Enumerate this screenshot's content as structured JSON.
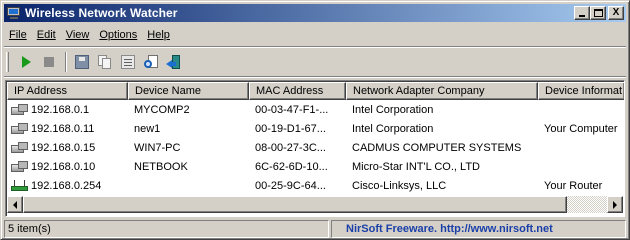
{
  "window": {
    "title": "Wireless Network Watcher",
    "icon": "computer-monitor-icon"
  },
  "titlebar_buttons": {
    "minimize": "minimize",
    "maximize": "maximize",
    "close": "X"
  },
  "menu": [
    {
      "label": "File"
    },
    {
      "label": "Edit"
    },
    {
      "label": "View"
    },
    {
      "label": "Options"
    },
    {
      "label": "Help"
    }
  ],
  "toolbar": {
    "buttons": [
      {
        "icon": "play-icon"
      },
      {
        "icon": "stop-icon"
      },
      {
        "icon": "save-icon"
      },
      {
        "icon": "copy-icon"
      },
      {
        "icon": "properties-icon"
      },
      {
        "icon": "find-icon"
      },
      {
        "icon": "exit-icon"
      }
    ]
  },
  "table": {
    "columns": [
      "IP Address",
      "Device Name",
      "MAC Address",
      "Network Adapter Company",
      "Device Informat"
    ],
    "rows": [
      {
        "icon": "computer",
        "ip": "192.168.0.1",
        "name": "MYCOMP2",
        "mac": "00-03-47-F1-...",
        "company": "Intel Corporation",
        "info": ""
      },
      {
        "icon": "computer",
        "ip": "192.168.0.11",
        "name": "new1",
        "mac": "00-19-D1-67...",
        "company": "Intel Corporation",
        "info": "Your Computer"
      },
      {
        "icon": "computer",
        "ip": "192.168.0.15",
        "name": "WIN7-PC",
        "mac": "08-00-27-3C...",
        "company": "CADMUS COMPUTER SYSTEMS",
        "info": ""
      },
      {
        "icon": "computer",
        "ip": "192.168.0.10",
        "name": "NETBOOK",
        "mac": "6C-62-6D-10...",
        "company": "Micro-Star INT'L CO., LTD",
        "info": ""
      },
      {
        "icon": "router",
        "ip": "192.168.0.254",
        "name": "",
        "mac": "00-25-9C-64...",
        "company": "Cisco-Linksys, LLC",
        "info": "Your Router"
      }
    ]
  },
  "statusbar": {
    "count": "5 item(s)",
    "link": "NirSoft Freeware.  http://www.nirsoft.net"
  },
  "colors": {
    "title_gradient_start": "#0a246a",
    "title_gradient_end": "#a6caf0",
    "status_link": "#1a3fa8",
    "face": "#d4d0c8"
  }
}
